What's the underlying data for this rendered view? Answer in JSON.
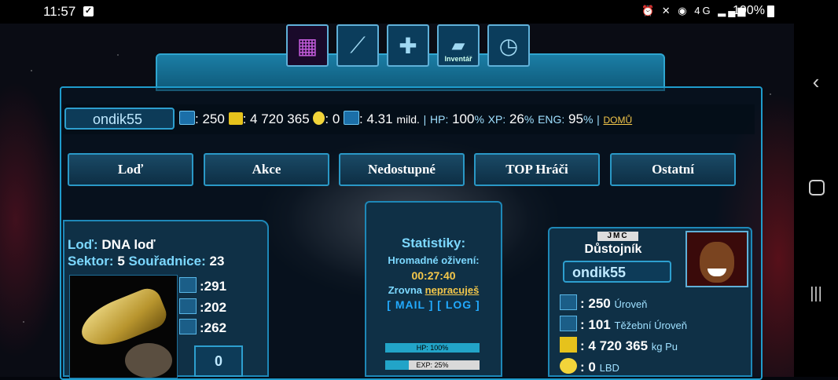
{
  "status_bar": {
    "time": "11:57",
    "icons": "⏰ ✕ ◉ 4G ▂▄▆",
    "battery": "100%"
  },
  "toolbar": {
    "inventory_label": "Inventář"
  },
  "hud": {
    "player_name": "ondik55",
    "level": "250",
    "radiation": "4 720 365",
    "coins": "0",
    "mild": "4.31",
    "mild_unit": "mild.",
    "hp_label": "HP:",
    "hp": "100",
    "xp_label": "XP:",
    "xp": "26",
    "eng_label": "ENG:",
    "eng": "95",
    "percent": "%",
    "home": "DOMŮ",
    "sep": "|"
  },
  "tabs": [
    "Loď",
    "Akce",
    "Nedostupné",
    "TOP Hráči",
    "Ostatní"
  ],
  "left": {
    "ship_label": "Loď:",
    "ship_name": "DNA loď",
    "sector_label": "Sektor:",
    "sector": "5",
    "coords_label": "Souřadnice:",
    "coords": "23",
    "stats": [
      ":291",
      ":202",
      ":262"
    ],
    "cargo": "0"
  },
  "center": {
    "title": "Statistiky:",
    "revive_label": "Hromadné oživení:",
    "revive_time": "00:27:40",
    "zrovna": "Zrovna",
    "nepracujes": "nepracuješ",
    "mail": "[ MAIL ]",
    "log": "[ LOG ]",
    "hp_bar": "HP: 100%",
    "hp_fill": 1.0,
    "exp_bar": "EXP: 25%",
    "exp_fill": 0.25
  },
  "right": {
    "corp": "JMC",
    "rank": "Důstojník",
    "name": "ondik55",
    "rows": [
      {
        "value": "250",
        "unit": "Úroveň"
      },
      {
        "value": "101",
        "unit": "Těžební Úroveň"
      },
      {
        "value": "4 720 365",
        "unit": "kg Pu"
      },
      {
        "value": "0",
        "unit": "LBD"
      }
    ]
  }
}
